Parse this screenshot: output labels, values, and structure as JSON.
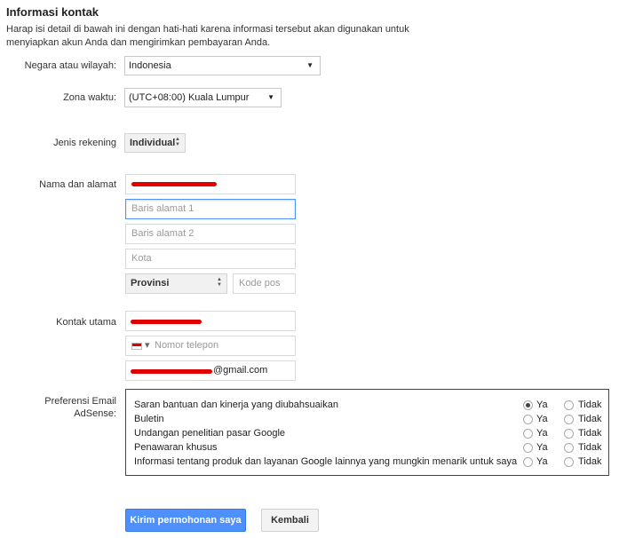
{
  "header": {
    "title": "Informasi kontak",
    "intro": "Harap isi detail di bawah ini dengan hati-hati karena informasi tersebut akan digunakan untuk menyiapkan akun Anda dan mengirimkan pembayaran Anda."
  },
  "form": {
    "country": {
      "label": "Negara atau wilayah:",
      "value": "Indonesia"
    },
    "timezone": {
      "label": "Zona waktu:",
      "value": "(UTC+08:00) Kuala Lumpur"
    },
    "account_type": {
      "label": "Jenis rekening",
      "value": "Individual"
    },
    "name_address": {
      "label": "Nama dan alamat",
      "address1_placeholder": "Baris alamat 1",
      "address2_placeholder": "Baris alamat 2",
      "city_placeholder": "Kota",
      "province_value": "Provinsi",
      "postal_placeholder": "Kode pos"
    },
    "primary_contact": {
      "label": "Kontak utama",
      "phone_placeholder": "Nomor telepon",
      "email_suffix": "@gmail.com"
    },
    "preferences": {
      "label_line1": "Preferensi Email",
      "label_line2": "AdSense:",
      "yes_label": "Ya",
      "no_label": "Tidak",
      "items": [
        {
          "label": "Saran bantuan dan kinerja yang diubahsuaikan",
          "selected": "yes"
        },
        {
          "label": "Buletin",
          "selected": ""
        },
        {
          "label": "Undangan penelitian pasar Google",
          "selected": ""
        },
        {
          "label": "Penawaran khusus",
          "selected": ""
        },
        {
          "label": "Informasi tentang produk dan layanan Google lainnya yang mungkin menarik untuk saya",
          "selected": ""
        }
      ]
    }
  },
  "actions": {
    "submit_label": "Kirim permohonan saya",
    "back_label": "Kembali"
  },
  "colors": {
    "primary_button": "#4d90fe",
    "redaction": "#e00000",
    "focus_border": "#4d90fe"
  }
}
